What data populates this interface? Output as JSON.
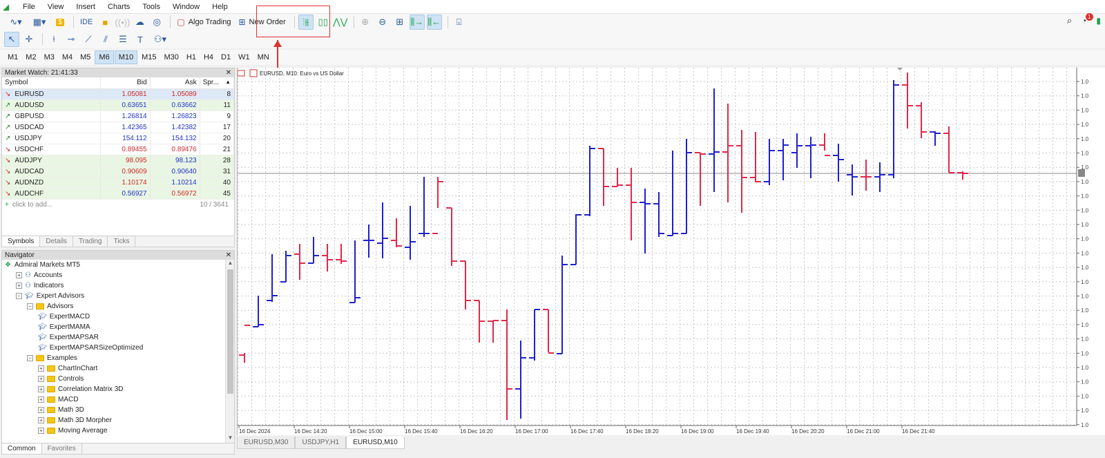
{
  "menu": [
    "File",
    "View",
    "Insert",
    "Charts",
    "Tools",
    "Window",
    "Help"
  ],
  "toolbar": {
    "ide_label": "IDE",
    "algo_label": "Algo Trading",
    "new_order_label": "New Order"
  },
  "timeframes": [
    "M1",
    "M2",
    "M3",
    "M4",
    "M5",
    "M6",
    "M10",
    "M15",
    "M30",
    "H1",
    "H4",
    "D1",
    "W1",
    "MN"
  ],
  "active_timeframes": [
    "M6",
    "M10"
  ],
  "notification_count": "1",
  "market_watch": {
    "title": "Market Watch: 21:41:33",
    "columns": [
      "Symbol",
      "Bid",
      "Ask",
      "Spr..."
    ],
    "rows": [
      {
        "symbol": "EURUSD",
        "bid": "1.05081",
        "ask": "1.05089",
        "spread": "8",
        "dir": "dn",
        "bidc": "dn",
        "askc": "dn",
        "style": "sel"
      },
      {
        "symbol": "AUDUSD",
        "bid": "0.63651",
        "ask": "0.63662",
        "spread": "11",
        "dir": "up",
        "bidc": "up",
        "askc": "up",
        "style": "green"
      },
      {
        "symbol": "GBPUSD",
        "bid": "1.26814",
        "ask": "1.26823",
        "spread": "9",
        "dir": "up",
        "bidc": "up",
        "askc": "up",
        "style": ""
      },
      {
        "symbol": "USDCAD",
        "bid": "1.42365",
        "ask": "1.42382",
        "spread": "17",
        "dir": "up",
        "bidc": "up",
        "askc": "up",
        "style": ""
      },
      {
        "symbol": "USDJPY",
        "bid": "154.112",
        "ask": "154.132",
        "spread": "20",
        "dir": "up",
        "bidc": "up",
        "askc": "up",
        "style": ""
      },
      {
        "symbol": "USDCHF",
        "bid": "0.89455",
        "ask": "0.89476",
        "spread": "21",
        "dir": "dn",
        "bidc": "dn",
        "askc": "dn",
        "style": ""
      },
      {
        "symbol": "AUDJPY",
        "bid": "98.095",
        "ask": "98.123",
        "spread": "28",
        "dir": "dn",
        "bidc": "dn",
        "askc": "up",
        "style": "green"
      },
      {
        "symbol": "AUDCAD",
        "bid": "0.90609",
        "ask": "0.90640",
        "spread": "31",
        "dir": "dn",
        "bidc": "dn",
        "askc": "up",
        "style": "green"
      },
      {
        "symbol": "AUDNZD",
        "bid": "1.10174",
        "ask": "1.10214",
        "spread": "40",
        "dir": "dn",
        "bidc": "dn",
        "askc": "up",
        "style": "green"
      },
      {
        "symbol": "AUDCHF",
        "bid": "0.56927",
        "ask": "0.56972",
        "spread": "45",
        "dir": "dn",
        "bidc": "up",
        "askc": "dn",
        "style": "green"
      }
    ],
    "add_label": "click to add...",
    "count": "10 / 3641",
    "tabs": [
      "Symbols",
      "Details",
      "Trading",
      "Ticks"
    ]
  },
  "navigator": {
    "title": "Navigator",
    "items": [
      {
        "label": "Admiral Markets MT5",
        "level": 0,
        "type": "root"
      },
      {
        "label": "Accounts",
        "level": 1,
        "type": "node"
      },
      {
        "label": "Indicators",
        "level": 1,
        "type": "node"
      },
      {
        "label": "Expert Advisors",
        "level": 1,
        "type": "open"
      },
      {
        "label": "Advisors",
        "level": 2,
        "type": "folder-open"
      },
      {
        "label": "ExpertMACD",
        "level": 3,
        "type": "ea"
      },
      {
        "label": "ExpertMAMA",
        "level": 3,
        "type": "ea"
      },
      {
        "label": "ExpertMAPSAR",
        "level": 3,
        "type": "ea"
      },
      {
        "label": "ExpertMAPSARSizeOptimized",
        "level": 3,
        "type": "ea"
      },
      {
        "label": "Examples",
        "level": 2,
        "type": "folder-open"
      },
      {
        "label": "ChartInChart",
        "level": 3,
        "type": "folder"
      },
      {
        "label": "Controls",
        "level": 3,
        "type": "folder"
      },
      {
        "label": "Correlation Matrix 3D",
        "level": 3,
        "type": "folder"
      },
      {
        "label": "MACD",
        "level": 3,
        "type": "folder"
      },
      {
        "label": "Math 3D",
        "level": 3,
        "type": "folder"
      },
      {
        "label": "Math 3D Morpher",
        "level": 3,
        "type": "folder"
      },
      {
        "label": "Moving Average",
        "level": 3,
        "type": "folder"
      }
    ],
    "tabs": [
      "Common",
      "Favorites"
    ]
  },
  "chart": {
    "header": "EURUSD, M10:  Euro vs US Dollar",
    "time_labels": [
      "16 Dec 2024",
      "16 Dec 14:20",
      "16 Dec 15:00",
      "16 Dec 15:40",
      "16 Dec 16:20",
      "16 Dec 17:00",
      "16 Dec 17:40",
      "16 Dec 18:20",
      "16 Dec 19:00",
      "16 Dec 19:40",
      "16 Dec 20:20",
      "16 Dec 21:00",
      "16 Dec 21:40"
    ],
    "tabs": [
      "EURUSD,M30",
      "USDJPY,H1",
      "EURUSD,M10"
    ],
    "active_tab": "EURUSD,M10",
    "bull_color": "#1f1fcf",
    "bear_color": "#e0284a",
    "bars": [
      [
        0,
        416,
        413,
        427,
        373
      ],
      [
        1,
        375,
        330,
        375,
        372
      ],
      [
        1,
        337,
        270,
        339,
        330
      ],
      [
        1,
        310,
        265,
        310,
        272
      ],
      [
        0,
        270,
        255,
        307,
        283
      ],
      [
        1,
        283,
        245,
        283,
        272
      ],
      [
        0,
        272,
        255,
        295,
        278
      ],
      [
        0,
        278,
        255,
        284,
        280
      ],
      [
        1,
        340,
        250,
        340,
        333
      ],
      [
        1,
        250,
        227,
        275,
        250
      ],
      [
        1,
        254,
        195,
        276,
        247
      ],
      [
        0,
        250,
        218,
        260,
        258
      ],
      [
        1,
        260,
        200,
        278,
        252
      ],
      [
        1,
        240,
        158,
        245,
        240
      ],
      [
        0,
        240,
        158,
        203,
        165
      ],
      [
        0,
        203,
        203,
        287,
        280
      ],
      [
        0,
        280,
        280,
        350,
        337
      ],
      [
        0,
        337,
        337,
        398,
        367
      ],
      [
        0,
        367,
        367,
        398,
        366
      ],
      [
        0,
        366,
        350,
        510,
        465
      ],
      [
        1,
        465,
        395,
        508,
        420
      ],
      [
        1,
        420,
        350,
        424,
        350
      ],
      [
        0,
        350,
        350,
        412,
        413
      ],
      [
        1,
        414,
        272,
        414,
        285
      ],
      [
        1,
        285,
        212,
        285,
        213
      ],
      [
        1,
        213,
        113,
        215,
        117
      ],
      [
        0,
        117,
        117,
        200,
        172
      ],
      [
        0,
        172,
        145,
        172,
        170
      ],
      [
        0,
        170,
        145,
        250,
        195
      ],
      [
        1,
        195,
        175,
        269,
        197
      ],
      [
        1,
        197,
        180,
        245,
        240
      ],
      [
        1,
        243,
        120,
        243,
        240
      ],
      [
        1,
        240,
        103,
        240,
        123
      ],
      [
        0,
        123,
        123,
        200,
        125
      ],
      [
        1,
        125,
        30,
        180,
        122
      ],
      [
        0,
        122,
        52,
        195,
        113
      ],
      [
        0,
        113,
        90,
        210,
        159
      ],
      [
        0,
        159,
        93,
        166,
        165
      ],
      [
        1,
        165,
        103,
        170,
        120
      ],
      [
        1,
        120,
        103,
        163,
        112
      ],
      [
        1,
        123,
        95,
        145,
        113
      ],
      [
        1,
        113,
        100,
        160,
        112
      ],
      [
        0,
        112,
        95,
        120,
        127
      ],
      [
        1,
        127,
        110,
        165,
        133
      ],
      [
        1,
        155,
        140,
        185,
        158
      ],
      [
        0,
        158,
        133,
        178,
        158
      ],
      [
        1,
        158,
        137,
        180,
        155
      ],
      [
        1,
        155,
        18,
        160,
        25
      ],
      [
        0,
        25,
        7,
        88,
        55
      ],
      [
        0,
        55,
        50,
        102,
        93
      ],
      [
        1,
        93,
        92,
        113,
        95
      ],
      [
        0,
        95,
        85,
        152,
        152
      ],
      [
        0,
        152,
        150,
        162,
        153
      ]
    ]
  }
}
